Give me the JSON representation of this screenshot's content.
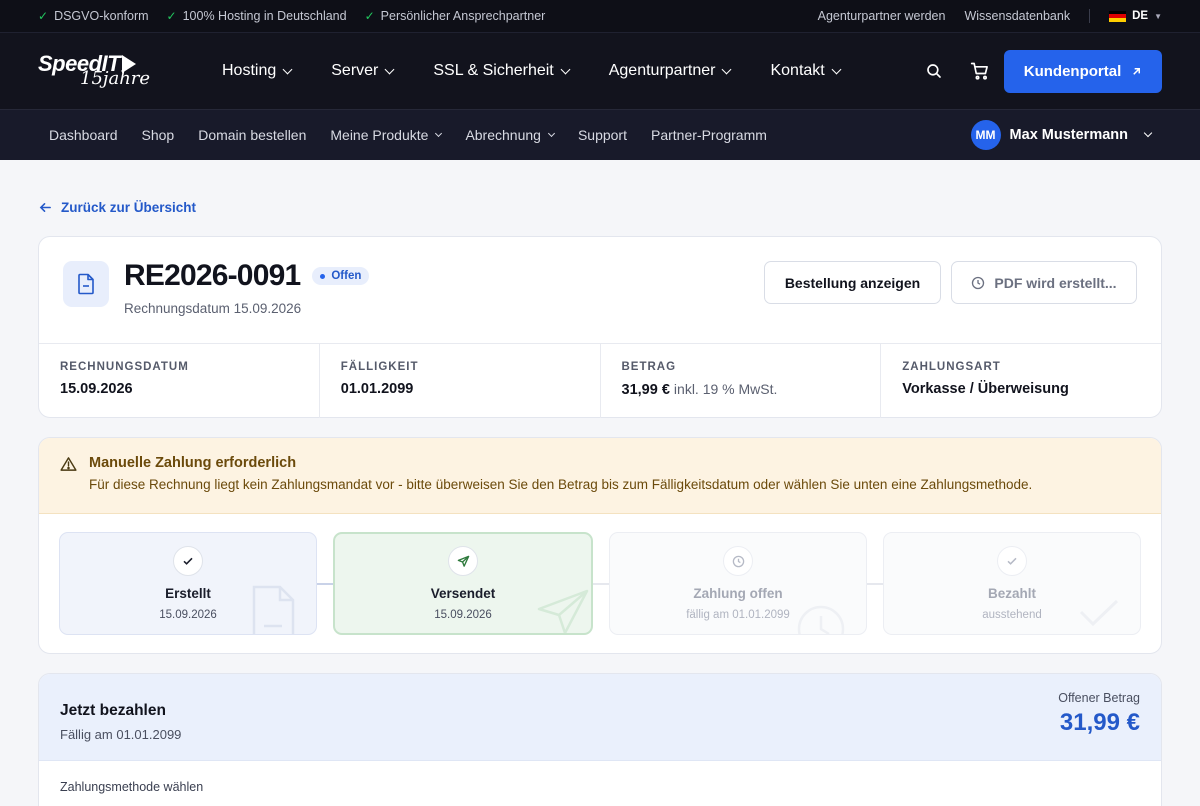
{
  "topbar": {
    "usps": [
      "DSGVO-konform",
      "100% Hosting in Deutschland",
      "Persönlicher Ansprechpartner"
    ],
    "links": [
      "Agenturpartner werden",
      "Wissensdatenbank"
    ],
    "lang": "DE"
  },
  "brand": {
    "name": "SpeedIT",
    "tagline": "15jahre"
  },
  "mainnav": {
    "items": [
      "Hosting",
      "Server",
      "SSL & Sicherheit",
      "Agenturpartner",
      "Kontakt"
    ],
    "portal_label": "Kundenportal"
  },
  "subnav": {
    "items": [
      "Dashboard",
      "Shop",
      "Domain bestellen",
      "Meine Produkte",
      "Abrechnung",
      "Support",
      "Partner-Programm"
    ],
    "user_initials": "MM",
    "user_name": "Max Mustermann"
  },
  "back_label": "Zurück zur Übersicht",
  "invoice": {
    "number": "RE2026-0091",
    "status": "Offen",
    "date_line": "Rechnungsdatum 15.09.2026",
    "btn_order": "Bestellung anzeigen",
    "btn_pdf": "PDF wird erstellt...",
    "meta": [
      {
        "label": "RECHNUNGSDATUM",
        "value": "15.09.2026",
        "sub": ""
      },
      {
        "label": "FÄLLIGKEIT",
        "value": "01.01.2099",
        "sub": ""
      },
      {
        "label": "BETRAG",
        "value": "31,99 €",
        "sub": "inkl. 19 % MwSt."
      },
      {
        "label": "ZAHLUNGSART",
        "value": "Vorkasse / Überweisung",
        "sub": ""
      }
    ]
  },
  "alert": {
    "title": "Manuelle Zahlung erforderlich",
    "text": "Für diese Rechnung liegt kein Zahlungsmandat vor - bitte überweisen Sie den Betrag bis zum Fälligkeitsdatum oder wählen Sie unten eine Zahlungsmethode."
  },
  "steps": [
    {
      "label": "Erstellt",
      "sub": "15.09.2026",
      "state": "done"
    },
    {
      "label": "Versendet",
      "sub": "15.09.2026",
      "state": "current"
    },
    {
      "label": "Zahlung offen",
      "sub": "fällig am 01.01.2099",
      "state": "pending"
    },
    {
      "label": "Bezahlt",
      "sub": "ausstehend",
      "state": "pending"
    }
  ],
  "pay": {
    "title": "Jetzt bezahlen",
    "due": "Fällig am 01.01.2099",
    "open_label": "Offener Betrag",
    "open_amount": "31,99 €",
    "method_label": "Zahlungsmethode wählen"
  },
  "colors": {
    "accent": "#2563eb",
    "dark": "#12131d",
    "alert_bg": "#fdf3e2",
    "success_bg": "#edf6ee"
  }
}
